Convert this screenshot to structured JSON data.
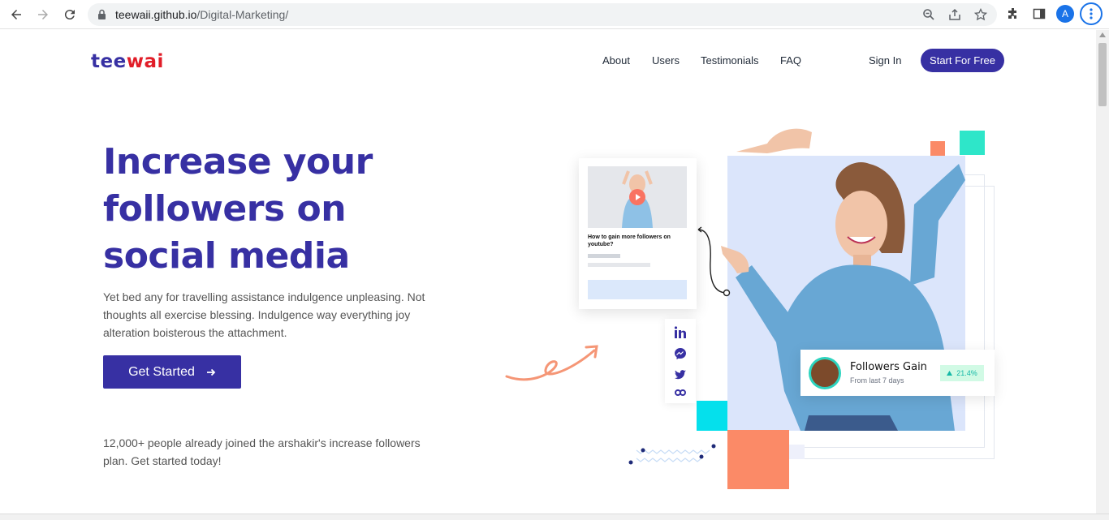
{
  "browser": {
    "url_domain": "teewaii.github.io",
    "url_path": "/Digital-Marketing/",
    "profile_initial": "A",
    "accent_color": "#1a73e8"
  },
  "site": {
    "logo_part1": "tee",
    "logo_part2": "wai",
    "brand_color": "#3730a3",
    "logo_accent_color": "#e11d28",
    "nav": [
      "About",
      "Users",
      "Testimonials",
      "FAQ"
    ],
    "sign_in": "Sign In",
    "cta": "Start For Free"
  },
  "hero": {
    "title": "Increase your followers on social media",
    "description": "Yet bed any for travelling assistance indulgence unpleasing. Not thoughts all exercise blessing. Indulgence way everything joy alteration boisterous the attachment.",
    "button": "Get Started",
    "joined": "12,000+ people already joined the arshakir's increase followers plan. Get started today!"
  },
  "video_card": {
    "caption": "How to gain more followers on youtube?"
  },
  "social_icons": [
    "linkedin-icon",
    "messenger-icon",
    "twitter-icon",
    "link-icon"
  ],
  "followers_card": {
    "title": "Followers Gain",
    "subtitle": "From last 7 days",
    "badge": "21.4%"
  }
}
